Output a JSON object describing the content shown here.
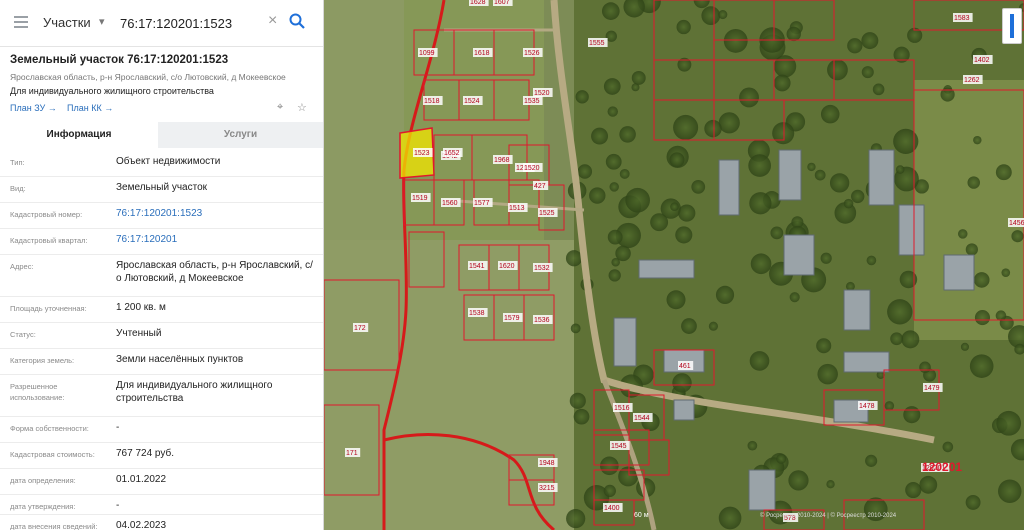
{
  "search": {
    "category": "Участки",
    "query": "76:17:120201:1523"
  },
  "parcel": {
    "title": "Земельный участок 76:17:120201:1523",
    "address": "Ярославская область, р-н Ярославский, с/о Лютовский, д Мокеевское",
    "usage": "Для индивидуального жилищного строительства",
    "plan_zu": "План ЗУ",
    "plan_kk": "План КК"
  },
  "tabs": {
    "info": "Информация",
    "services": "Услуги"
  },
  "properties": [
    {
      "label": "Тип:",
      "value": "Объект недвижимости",
      "link": false
    },
    {
      "label": "Вид:",
      "value": "Земельный участок",
      "link": false
    },
    {
      "label": "Кадастровый номер:",
      "value": "76:17:120201:1523",
      "link": true
    },
    {
      "label": "Кадастровый квартал:",
      "value": "76:17:120201",
      "link": true
    },
    {
      "label": "Адрес:",
      "value": "Ярославская область, р-н Ярославский, с/о Лютовский, д Мокеевское",
      "link": false
    },
    {
      "label": "Площадь уточненная:",
      "value": "1 200 кв. м",
      "link": false
    },
    {
      "label": "Статус:",
      "value": "Учтенный",
      "link": false
    },
    {
      "label": "Категория земель:",
      "value": "Земли населённых пунктов",
      "link": false
    },
    {
      "label": "Разрешенное использование:",
      "value": "Для индивидуального жилищного строительства",
      "link": false
    },
    {
      "label": "Форма собственности:",
      "value": "-",
      "link": false
    },
    {
      "label": "Кадастровая стоимость:",
      "value": "767 724 руб.",
      "link": false
    },
    {
      "label": "дата определения:",
      "value": "01.01.2022",
      "link": false
    },
    {
      "label": "дата утверждения:",
      "value": "-",
      "link": false
    },
    {
      "label": "дата внесения сведений:",
      "value": "04.02.2023",
      "link": false
    }
  ],
  "map": {
    "parcel_labels": [
      "1628",
      "1607",
      "1583",
      "1099",
      "1618",
      "1526",
      "1555",
      "1520",
      "1518",
      "1524",
      "1642",
      "1535",
      "1402",
      "1262",
      "1523",
      "1652",
      "1968",
      "1203",
      "427",
      "1519",
      "1560",
      "1577",
      "1513",
      "1525",
      "1456",
      "1520",
      "1541",
      "1620",
      "1532",
      "172",
      "1538",
      "1579",
      "1536",
      "461",
      "1479",
      "1478",
      "1516",
      "1544",
      "1545",
      "1948",
      "3215",
      "1400",
      "171",
      "120201",
      "578"
    ],
    "quarter_label": "120201",
    "scale_label": "60 м",
    "copyright": "© Росреестр 2010-2024 | © Росреестр 2010-2024"
  },
  "colors": {
    "link": "#2a6ebb",
    "parcel_border": "#e0182d",
    "selected_fill": "#f2e600",
    "boundary": "#d61a1a",
    "zoom_accent": "#1e6fd9"
  }
}
